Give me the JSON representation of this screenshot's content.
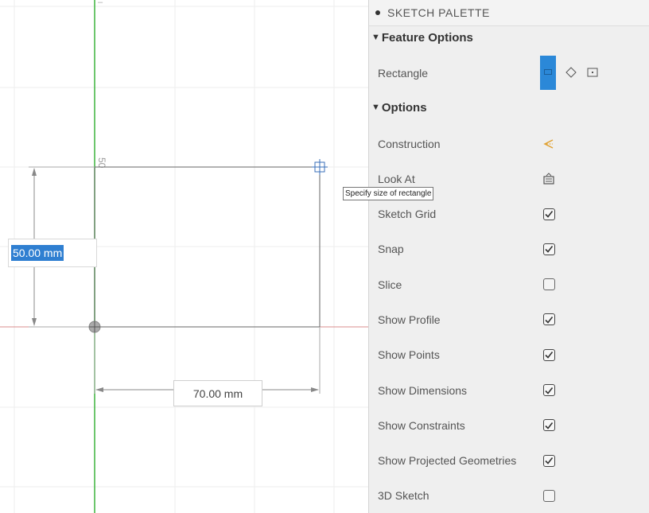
{
  "canvas": {
    "axis_label_50": "50",
    "dim_height_value": "50.00 mm",
    "dim_width_value": "70.00 mm",
    "tooltip": "Specify size of rectangle"
  },
  "palette": {
    "title": "SKETCH PALETTE",
    "feature_options": {
      "heading": "Feature Options",
      "rectangle_label": "Rectangle",
      "modes": [
        "2-point-rectangle-icon",
        "3-point-rectangle-icon",
        "center-rectangle-icon"
      ]
    },
    "options": {
      "heading": "Options",
      "construction_label": "Construction",
      "look_at_label": "Look At",
      "items": [
        {
          "label": "Sketch Grid",
          "checked": true
        },
        {
          "label": "Snap",
          "checked": true
        },
        {
          "label": "Slice",
          "checked": false
        },
        {
          "label": "Show Profile",
          "checked": true
        },
        {
          "label": "Show Points",
          "checked": true
        },
        {
          "label": "Show Dimensions",
          "checked": true
        },
        {
          "label": "Show Constraints",
          "checked": true
        },
        {
          "label": "Show Projected Geometries",
          "checked": true
        },
        {
          "label": "3D Sketch",
          "checked": false
        }
      ]
    }
  },
  "colors": {
    "accent": "#2b88d8",
    "y_axis": "#3bb33b",
    "x_axis": "#d98c8c",
    "construction_icon": "#e0a030"
  }
}
